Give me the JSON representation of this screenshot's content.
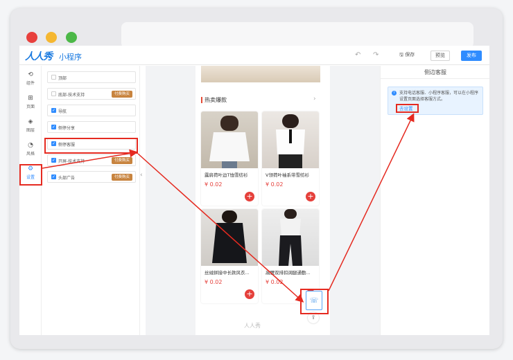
{
  "app": {
    "logo": "人人秀",
    "logo_sub": "小程序",
    "save_label": "保存",
    "preview_label": "预览",
    "publish_label": "发布"
  },
  "left_nav": [
    {
      "label": "组件",
      "icon": "component-icon"
    },
    {
      "label": "页面",
      "icon": "page-icon"
    },
    {
      "label": "图层",
      "icon": "layers-icon"
    },
    {
      "label": "风格",
      "icon": "style-icon"
    },
    {
      "label": "设置",
      "icon": "settings-icon",
      "active": true
    }
  ],
  "components": [
    {
      "label": "顶部",
      "checked": false,
      "badge": ""
    },
    {
      "label": "底部-技术支持",
      "checked": false,
      "badge": "付费购买"
    },
    {
      "label": "导航",
      "checked": true,
      "badge": ""
    },
    {
      "label": "侧停分享",
      "checked": true,
      "badge": ""
    },
    {
      "label": "侧停客服",
      "checked": true,
      "badge": ""
    },
    {
      "label": "开屏-技术支持",
      "checked": true,
      "badge": "付费购买"
    },
    {
      "label": "头部广告",
      "checked": true,
      "badge": "付费购买"
    }
  ],
  "phone": {
    "section_title": "热卖爆款",
    "products": [
      {
        "name": "露肩荷叶边T恤雪纺衫",
        "price": "¥ 0.02"
      },
      {
        "name": "V领荷叶袖系带雪纺衫",
        "price": "¥ 0.02"
      },
      {
        "name": "丝绒拼接中长款风衣...",
        "price": "¥ 0.02"
      },
      {
        "name": "高腰双排扣阔腿通勤...",
        "price": "¥ 0.02"
      }
    ],
    "footer_logo": "人人秀"
  },
  "right_panel": {
    "title": "侧边客服",
    "info_text": "支持电话客服、小程序客服，可以在小程序设置页面选择客服方式。",
    "link": "去设置"
  },
  "colors": {
    "accent": "#2f8cff",
    "price_red": "#e5403b",
    "annotation_red": "#e52a20",
    "paid_badge": "#c8843f"
  }
}
